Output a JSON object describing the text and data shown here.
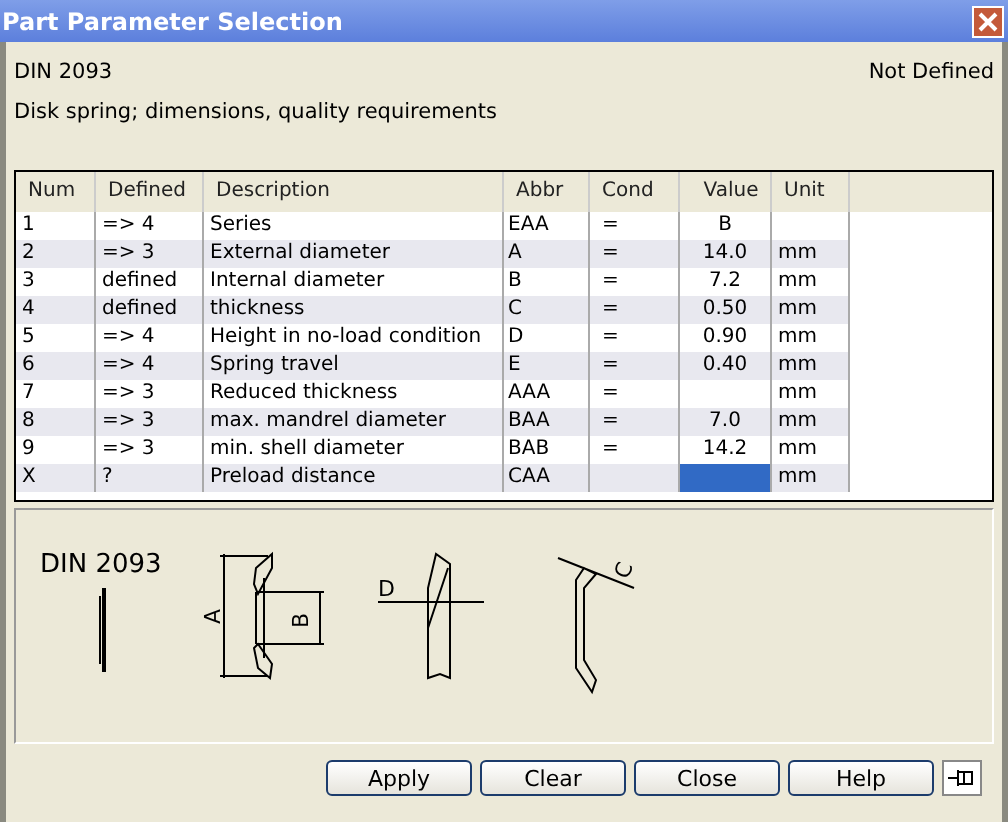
{
  "window": {
    "title": "Part Parameter Selection"
  },
  "header": {
    "standard": "DIN 2093",
    "status": "Not Defined",
    "description": "Disk spring; dimensions, quality requirements"
  },
  "table": {
    "columns": [
      "Num",
      "Defined",
      "Description",
      "Abbr",
      "Cond",
      "Value",
      "Unit"
    ],
    "rows": [
      {
        "num": "1",
        "defined": "=> 4",
        "description": "Series",
        "abbr": "EAA",
        "cond": "=",
        "value": "B",
        "unit": "",
        "selected": false
      },
      {
        "num": "2",
        "defined": "=> 3",
        "description": "External diameter",
        "abbr": "A",
        "cond": "=",
        "value": "14.0",
        "unit": "mm",
        "selected": false
      },
      {
        "num": "3",
        "defined": "defined",
        "description": "Internal diameter",
        "abbr": "B",
        "cond": "=",
        "value": "7.2",
        "unit": "mm",
        "selected": false
      },
      {
        "num": "4",
        "defined": "defined",
        "description": "thickness",
        "abbr": "C",
        "cond": "=",
        "value": "0.50",
        "unit": "mm",
        "selected": false
      },
      {
        "num": "5",
        "defined": "=> 4",
        "description": "Height in no-load condition",
        "abbr": "D",
        "cond": "=",
        "value": "0.90",
        "unit": "mm",
        "selected": false
      },
      {
        "num": "6",
        "defined": "=> 4",
        "description": "Spring travel",
        "abbr": "E",
        "cond": "=",
        "value": "0.40",
        "unit": "mm",
        "selected": false
      },
      {
        "num": "7",
        "defined": "=> 3",
        "description": "Reduced thickness",
        "abbr": "AAA",
        "cond": "=",
        "value": "",
        "unit": "mm",
        "selected": false
      },
      {
        "num": "8",
        "defined": "=> 3",
        "description": "max. mandrel diameter",
        "abbr": "BAA",
        "cond": "=",
        "value": "7.0",
        "unit": "mm",
        "selected": false
      },
      {
        "num": "9",
        "defined": "=> 3",
        "description": "min. shell diameter",
        "abbr": "BAB",
        "cond": "=",
        "value": "14.2",
        "unit": "mm",
        "selected": false
      },
      {
        "num": "X",
        "defined": "?",
        "description": "Preload distance",
        "abbr": "CAA",
        "cond": "",
        "value": "",
        "unit": "mm",
        "selected": true
      }
    ]
  },
  "drawing": {
    "standard": "DIN 2093",
    "labels": [
      "A",
      "B",
      "D",
      "C"
    ]
  },
  "buttons": [
    "Apply",
    "Clear",
    "Close",
    "Help"
  ]
}
